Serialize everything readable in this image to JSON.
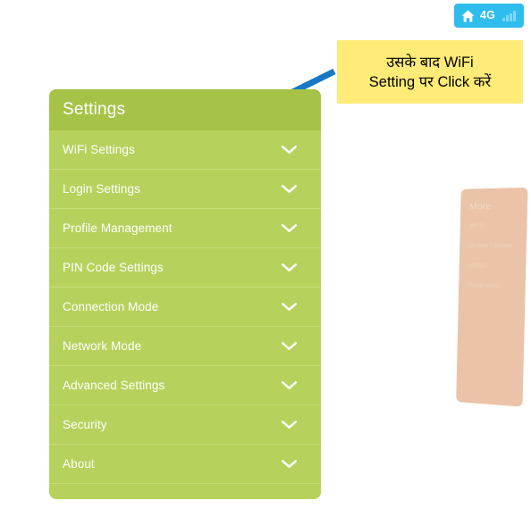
{
  "status_bar": {
    "home_icon": "home-icon",
    "network_label": "4G",
    "signal_icon": "signal-bars-icon",
    "badge_color": "#2ebdec"
  },
  "annotation": {
    "callout_line_1": "उसके बाद WiFi",
    "callout_line_2": "Setting पर Click करें",
    "callout_bg": "#ffeb77",
    "arrow_color": "#1878c4",
    "arrow_target": "WiFi Settings"
  },
  "settings_panel": {
    "header_title": "Settings",
    "header_color": "#a6c348",
    "body_color": "#b6d25c",
    "chevron_icon": "chevron-down-icon",
    "items": [
      {
        "label": "WiFi Settings"
      },
      {
        "label": "Login Settings"
      },
      {
        "label": "Profile Management"
      },
      {
        "label": "PIN Code Settings"
      },
      {
        "label": "Connection Mode"
      },
      {
        "label": "Network Mode"
      },
      {
        "label": "Advanced Settings"
      },
      {
        "label": "Security"
      },
      {
        "label": "About"
      }
    ]
  },
  "more_panel": {
    "header_title": "More",
    "panel_color": "#e2ab85",
    "items": [
      {
        "label": "WPS"
      },
      {
        "label": "Online Update"
      },
      {
        "label": "USSD"
      },
      {
        "label": "Diagnostic"
      }
    ]
  }
}
